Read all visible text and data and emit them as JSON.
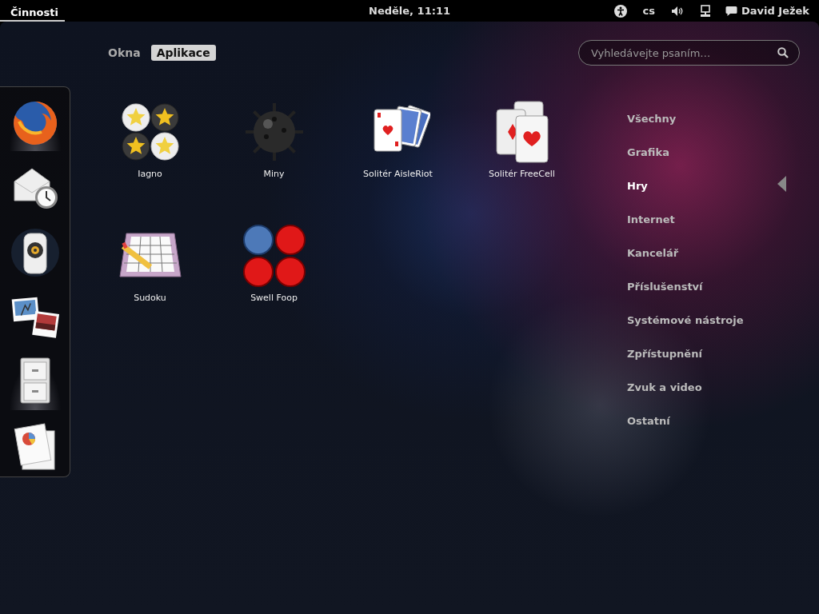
{
  "top_bar": {
    "activities": {
      "label": "Činnosti",
      "selected": true
    },
    "clock": "Neděle, 11:11",
    "keyboard_layout": "cs",
    "user": "David Ježek"
  },
  "dash": [
    {
      "kind": "browser",
      "running": true
    },
    {
      "kind": "mail",
      "running": false
    },
    {
      "kind": "audio",
      "running": false
    },
    {
      "kind": "photos",
      "running": false
    },
    {
      "kind": "files",
      "running": true
    },
    {
      "kind": "office",
      "running": false
    }
  ],
  "view_switcher": [
    {
      "label": "Okna",
      "selected": false
    },
    {
      "label": "Aplikace",
      "selected": true
    }
  ],
  "search": {
    "placeholder": "Vyhledávejte psaním…"
  },
  "apps": [
    {
      "name": "Iagno",
      "kind": "pieces"
    },
    {
      "name": "Miny",
      "kind": "mine"
    },
    {
      "name": "Solitér AisleRiot",
      "kind": "cards"
    },
    {
      "name": "Solitér FreeCell",
      "kind": "freecell"
    },
    {
      "name": "Sudoku",
      "kind": "sudoku"
    },
    {
      "name": "Swell Foop",
      "kind": "balls"
    }
  ],
  "categories": [
    {
      "label": "Všechny",
      "selected": false
    },
    {
      "label": "Grafika",
      "selected": false
    },
    {
      "label": "Hry",
      "selected": true
    },
    {
      "label": "Internet",
      "selected": false
    },
    {
      "label": "Kancelář",
      "selected": false
    },
    {
      "label": "Příslušenství",
      "selected": false
    },
    {
      "label": "Systémové nástroje",
      "selected": false
    },
    {
      "label": "Zpřístupnění",
      "selected": false
    },
    {
      "label": "Zvuk a video",
      "selected": false
    },
    {
      "label": "Ostatní",
      "selected": false
    }
  ]
}
